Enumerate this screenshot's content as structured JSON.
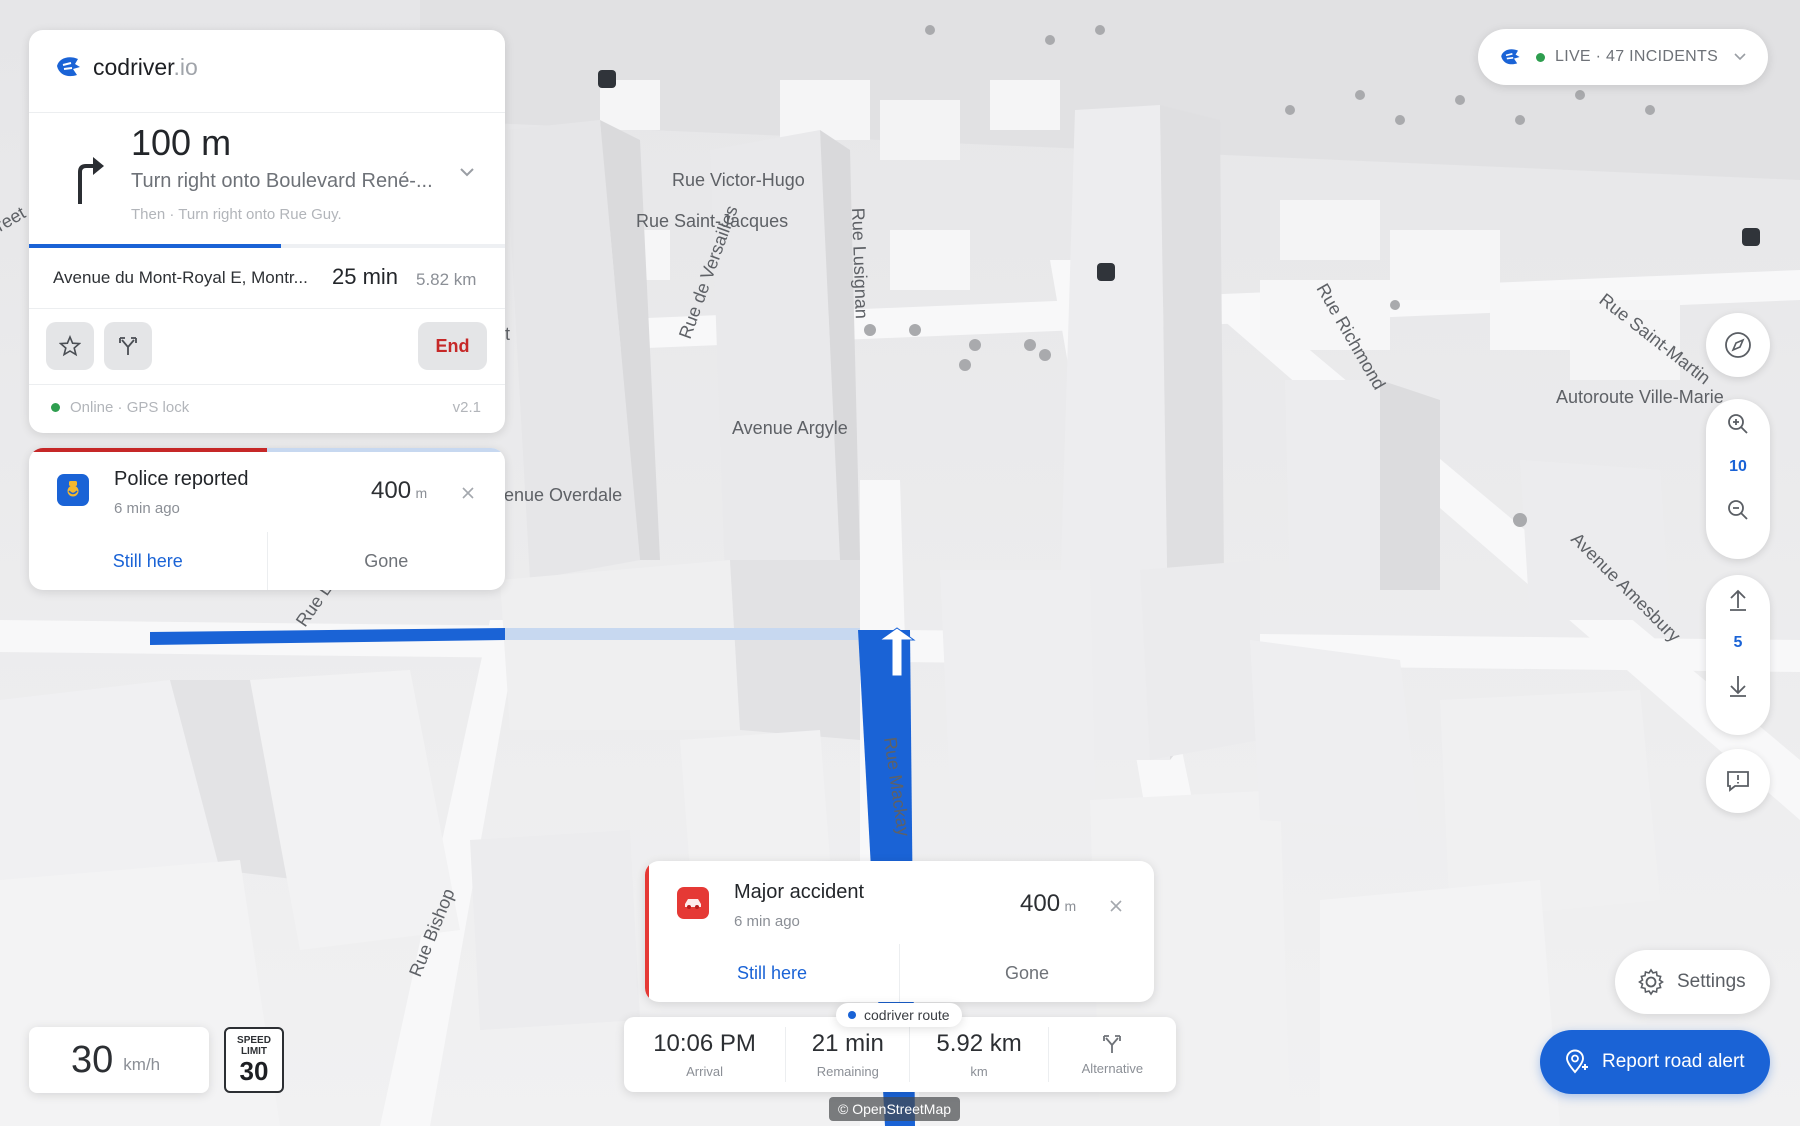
{
  "brand": {
    "name": "codriver",
    "suffix": ".io"
  },
  "nav": {
    "distance": "100 m",
    "instruction": "Turn right onto Boulevard René-...",
    "then": "Then · Turn right onto Rue Guy.",
    "progress": 0.53,
    "destination": "Avenue du Mont-Royal E, Montr...",
    "eta_min": "25 min",
    "eta_km": "5.82 km",
    "end_label": "End",
    "status": "Online · GPS lock",
    "version": "v2.1"
  },
  "alerts": [
    {
      "title": "Police reported",
      "time": "6 min ago",
      "distance": "400",
      "unit": "m",
      "still": "Still here",
      "gone": "Gone",
      "color": "#1a63d6"
    },
    {
      "title": "Major accident",
      "time": "6 min ago",
      "distance": "400",
      "unit": "m",
      "still": "Still here",
      "gone": "Gone",
      "color": "#e53935"
    }
  ],
  "live": {
    "label": "LIVE · 47 INCIDENTS"
  },
  "controls": {
    "zoom_level": "10",
    "pitch_level": "5"
  },
  "speed": {
    "value": "30",
    "unit": "km/h",
    "limit_label_1": "SPEED",
    "limit_label_2": "LIMIT",
    "limit_value": "30"
  },
  "trip": {
    "route_tag": "codriver route",
    "arrival": "10:06 PM",
    "arrival_label": "Arrival",
    "remaining": "21 min",
    "remaining_label": "Remaining",
    "distance": "5.92 km",
    "distance_label": "km",
    "alt_label": "Alternative"
  },
  "settings_label": "Settings",
  "report_label": "Report road alert",
  "attribution": "© OpenStreetMap",
  "streets": {
    "victor_hugo": "Rue Victor-Hugo",
    "saint_jacques": "Rue Saint-Jacques",
    "versailles": "Rue de Versailles",
    "lusignan": "Rue Lusignan",
    "argyle": "Avenue Argyle",
    "overdale": "enue Overdale",
    "richmond": "Rue Richmond",
    "saint_martin": "Rue Saint-Martin",
    "ville_marie": "Autoroute Ville-Marie",
    "amesbury": "Avenue Amesbury",
    "mackay": "Rue Mackay",
    "bishop": "Rue Bishop",
    "rue_l": "Rue L",
    "edge_tree": "reet",
    "edge_t": "t"
  },
  "colors": {
    "accent": "#1a63d6",
    "danger": "#c62828",
    "online": "#2e9e4f"
  }
}
